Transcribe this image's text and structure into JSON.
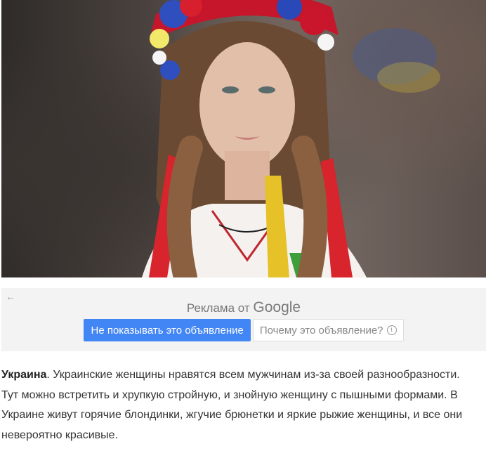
{
  "photo": {
    "alt_icon": "portrait-photo"
  },
  "ad": {
    "back_icon": "←",
    "title_prefix": "Реклама от",
    "title_brand": "Google",
    "hide_button": "Не показывать это объявление",
    "why_button": "Почему это объявление?",
    "info_icon": "i"
  },
  "article": {
    "heading": "Украина",
    "body": ". Украинские женщины нравятся всем мужчинам из-за своей разнообразности. Тут можно встретить и хрупкую стройную, и знойную женщину с пышными формами. В Украине живут горячие блондинки, жгучие брюнетки и яркие рыжие женщины, и все они невероятно красивые."
  },
  "colors": {
    "button_blue": "#4285f4",
    "panel_bg": "#f3f3f3"
  }
}
